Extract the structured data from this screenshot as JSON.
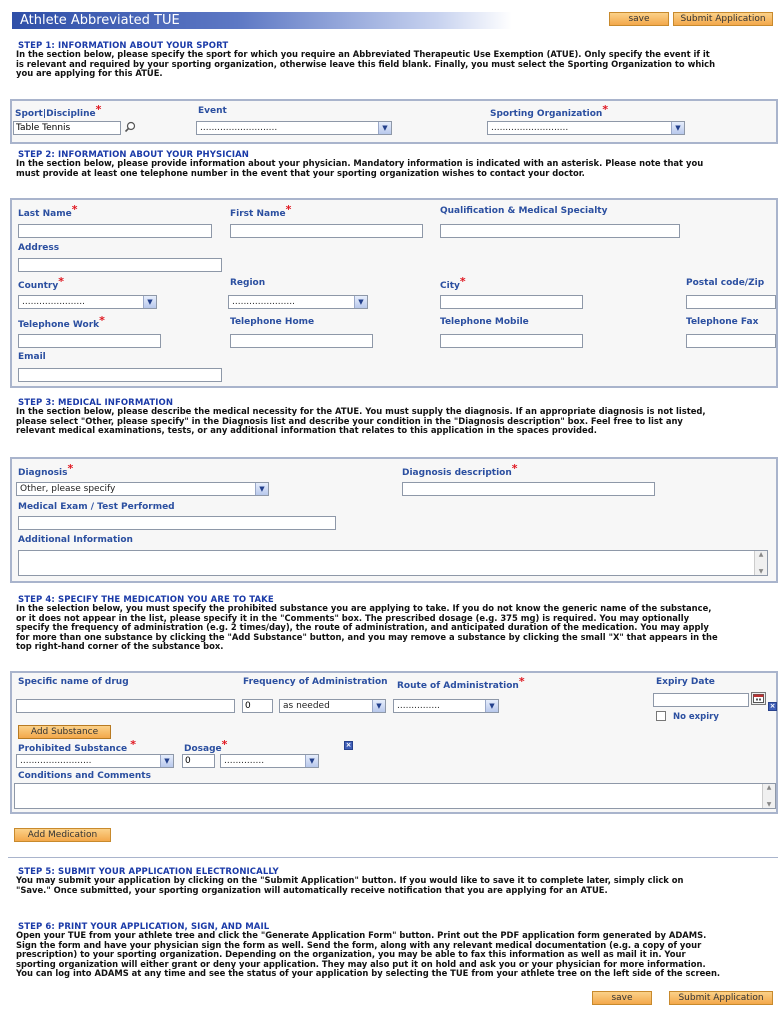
{
  "header": {
    "title": "Athlete Abbreviated TUE",
    "save_label": "save",
    "submit_label": "Submit Application"
  },
  "step1": {
    "title": "STEP 1: INFORMATION ABOUT YOUR SPORT",
    "lines": [
      "In the section below, please specify the sport for which you require an Abbreviated Therapeutic Use Exemption (ATUE). Only specify the event if it",
      "is relevant and required by your sporting organization, otherwise leave this field blank. Finally, you must select the Sporting Organization to which",
      "you are applying for this ATUE."
    ],
    "sport_label": "Sport|Discipline",
    "sport_value": "Table Tennis",
    "event_label": "Event",
    "event_value": "...........................",
    "org_label": "Sporting Organization",
    "org_value": "..........................."
  },
  "step2": {
    "title": "STEP 2: INFORMATION ABOUT YOUR PHYSICIAN",
    "lines": [
      "In the section below, please provide information about your physician. Mandatory information is indicated with an asterisk. Please note that you",
      "must provide at least one telephone number in the event that your sporting organization wishes to contact your doctor."
    ],
    "last_name": "Last Name",
    "first_name": "First Name",
    "qualification": "Qualification & Medical Specialty",
    "address": "Address",
    "country": "Country",
    "country_value": "......................",
    "region": "Region",
    "region_value": "......................",
    "city": "City",
    "postal": "Postal code/Zip",
    "tel_work": "Telephone Work",
    "tel_home": "Telephone Home",
    "tel_mobile": "Telephone Mobile",
    "tel_fax": "Telephone Fax",
    "email": "Email"
  },
  "step3": {
    "title": "STEP 3: MEDICAL INFORMATION",
    "lines": [
      "In the section below, please describe the medical necessity for the ATUE. You must supply the diagnosis. If an appropriate diagnosis is not listed,",
      "please select \"Other, please specify\" in the Diagnosis list and describe your condition in the \"Diagnosis description\" box. Feel free to list any",
      "relevant medical examinations, tests, or any additional information that relates to this application in the spaces provided."
    ],
    "diagnosis": "Diagnosis",
    "diagnosis_value": "Other, please specify",
    "diagnosis_desc": "Diagnosis description",
    "exam": "Medical Exam / Test Performed",
    "additional": "Additional Information"
  },
  "step4": {
    "title": "STEP 4: SPECIFY THE MEDICATION YOU ARE TO TAKE",
    "lines": [
      "In the selection below, you must specify the prohibited substance you are applying to take. If you do not know the generic name of the substance,",
      "or it does not appear in the list, please specify it in the \"Comments\" box. The prescribed dosage (e.g. 375 mg) is required. You may optionally",
      "specify the frequency of administration (e.g. 2 times/day), the route of administration, and anticipated duration of the medication. You may apply",
      "for more than one substance by clicking the \"Add Substance\" button, and you may remove a substance by clicking the small \"X\" that appears in the",
      "top right-hand corner of the substance box."
    ],
    "drug_name": "Specific name of drug",
    "frequency": "Frequency of Administration",
    "frequency_num": "0",
    "frequency_value": "as needed",
    "route": "Route of Administration",
    "route_value": "...............",
    "expiry": "Expiry Date",
    "no_expiry": "No expiry",
    "add_substance": "Add Substance",
    "prohibited": "Prohibited Substance",
    "prohibited_value": ".........................",
    "dosage": "Dosage",
    "dosage_num": "0",
    "dosage_unit": "..............",
    "conditions": "Conditions and Comments",
    "add_medication": "Add Medication"
  },
  "step5": {
    "title": "STEP 5: SUBMIT YOUR APPLICATION ELECTRONICALLY",
    "lines": [
      "You may submit your application by clicking on the \"Submit Application\" button. If you would like to save it to complete later, simply click on",
      "\"Save.\" Once submitted, your sporting organization will automatically receive notification that you are applying for an ATUE."
    ]
  },
  "step6": {
    "title": "STEP 6: PRINT YOUR APPLICATION, SIGN, AND MAIL",
    "lines": [
      "Open your TUE from your athlete tree and click the \"Generate Application Form\" button. Print out the PDF application form generated by ADAMS.",
      "Sign the form and have your physician sign the form as well. Send the form, along with any relevant medical documentation (e.g. a copy of your",
      "prescription) to your sporting organization. Depending on the organization, you may be able to fax this information as well as mail it in. Your",
      "sporting organization will either grant or deny your application. They may also put it on hold and ask you or your physician for more information.",
      "You can log into ADAMS at any time and see the status of your application by selecting the TUE from your athlete tree on the left side of the screen."
    ]
  },
  "footer": {
    "save_label": "save",
    "submit_label": "Submit Application"
  },
  "icons": {
    "required": "*",
    "search": "magnifier-icon",
    "dropdown": "chevron-down-icon",
    "remove": "close-icon",
    "calendar": "calendar-icon"
  }
}
